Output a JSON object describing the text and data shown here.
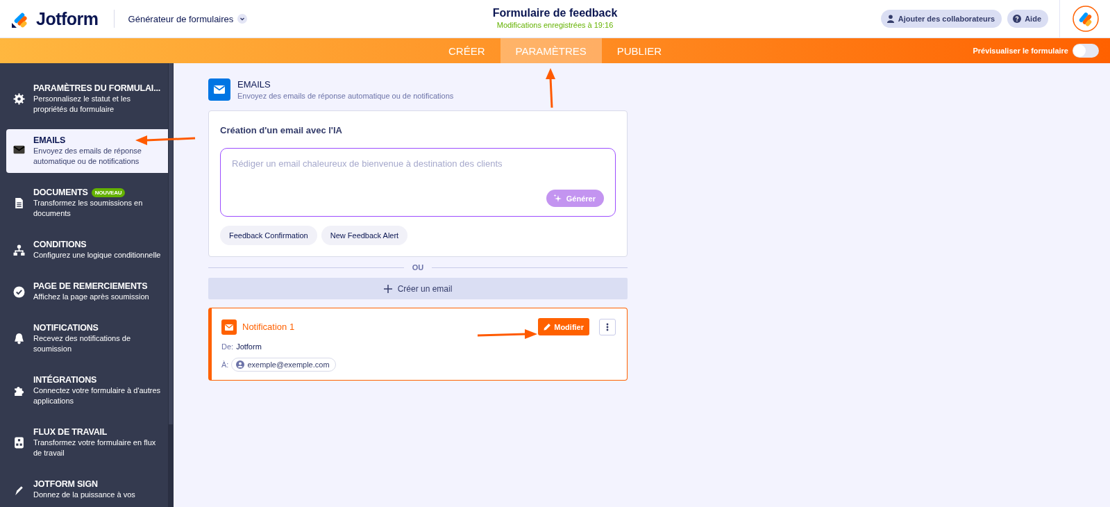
{
  "app": {
    "brand": "Jotform",
    "builder": "Générateur de formulaires"
  },
  "form": {
    "title": "Formulaire de feedback",
    "status": "Modifications enregistrées à 19:16"
  },
  "header_buttons": [
    {
      "label": "Ajouter des collaborateurs",
      "kind": "person"
    },
    {
      "label": "Aide",
      "kind": "help"
    }
  ],
  "tabs": [
    {
      "label": "CRÉER",
      "selected": false
    },
    {
      "label": "PARAMÈTRES",
      "selected": true
    },
    {
      "label": "PUBLIER",
      "selected": false
    }
  ],
  "preview": {
    "label": "Prévisualiser le formulaire",
    "on": false
  },
  "sidebar": {
    "items": [
      {
        "kind": "gear",
        "title": "PARAMÈTRES DU FORMULAI...",
        "description": "Personnalisez le statut et les propriétés du formulaire",
        "selected": false
      },
      {
        "kind": "mail",
        "title": "EMAILS",
        "description": "Envoyez des emails de réponse automatique ou de notifications",
        "selected": true
      },
      {
        "kind": "document",
        "title": "DOCUMENTS",
        "badge": "NOUVEAU",
        "description": "Transformez les soumissions en documents",
        "selected": false
      },
      {
        "kind": "hierarchy",
        "title": "CONDITIONS",
        "description": "Configurez une logique conditionnelle",
        "selected": false
      },
      {
        "kind": "check",
        "title": "PAGE DE REMERCIEMENTS",
        "description": "Affichez la page après soumission",
        "selected": false
      },
      {
        "kind": "bell",
        "title": "NOTIFICATIONS",
        "description": "Recevez des notifications de soumission",
        "selected": false
      },
      {
        "kind": "puzzle",
        "title": "INTÉGRATIONS",
        "description": "Connectez votre formulaire à d'autres applications",
        "selected": false
      },
      {
        "kind": "flow",
        "title": "FLUX DE TRAVAIL",
        "description": "Transformez votre formulaire en flux de travail",
        "selected": false
      },
      {
        "kind": "sign",
        "title": "JOTFORM SIGN",
        "description": "Donnez de la puissance à vos",
        "selected": false
      }
    ]
  },
  "section": {
    "title": "EMAILS",
    "description": "Envoyez des emails de réponse automatique ou de notifications"
  },
  "ai_card": {
    "title": "Création d'un email avec l'IA",
    "placeholder": "Rédiger un email chaleureux de bienvenue à destination des clients",
    "button": "Générer",
    "suggestions": [
      "Feedback Confirmation",
      "New Feedback Alert"
    ]
  },
  "divider": "OU",
  "create_button": "Créer un email",
  "notifications": [
    {
      "title": "Notification 1",
      "edit_button": "Modifier",
      "from_label": "De:",
      "from": "Jotform",
      "to_label": "À:",
      "to": "exemple@exemple.com"
    }
  ]
}
